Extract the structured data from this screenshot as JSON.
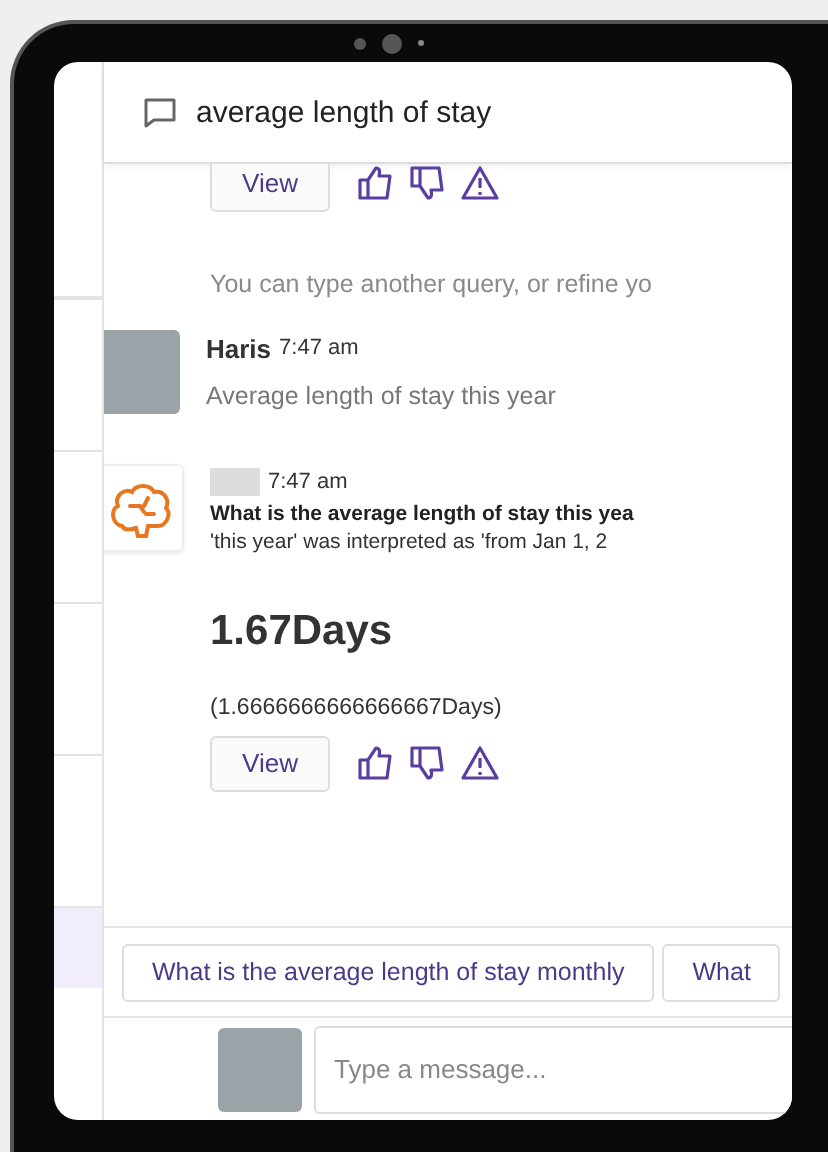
{
  "conversation": {
    "title": "average length of stay"
  },
  "messages": [
    {
      "kind": "actions",
      "button": "View"
    },
    {
      "kind": "note",
      "text": "You can type another query, or refine yo"
    },
    {
      "kind": "user",
      "author": "Haris",
      "time": "7:47 am",
      "text": "Average length of stay this year"
    },
    {
      "kind": "bot",
      "time": "7:47 am",
      "question": "What is the average length of stay this yea",
      "interpretation": "'this year' was interpreted as 'from Jan 1, 2",
      "value": "1.67Days",
      "exact": "(1.6666666666666667Days)",
      "button": "View"
    }
  ],
  "suggestions": [
    "What is the average length of stay monthly",
    "What"
  ],
  "composer": {
    "placeholder": "Type a message..."
  }
}
